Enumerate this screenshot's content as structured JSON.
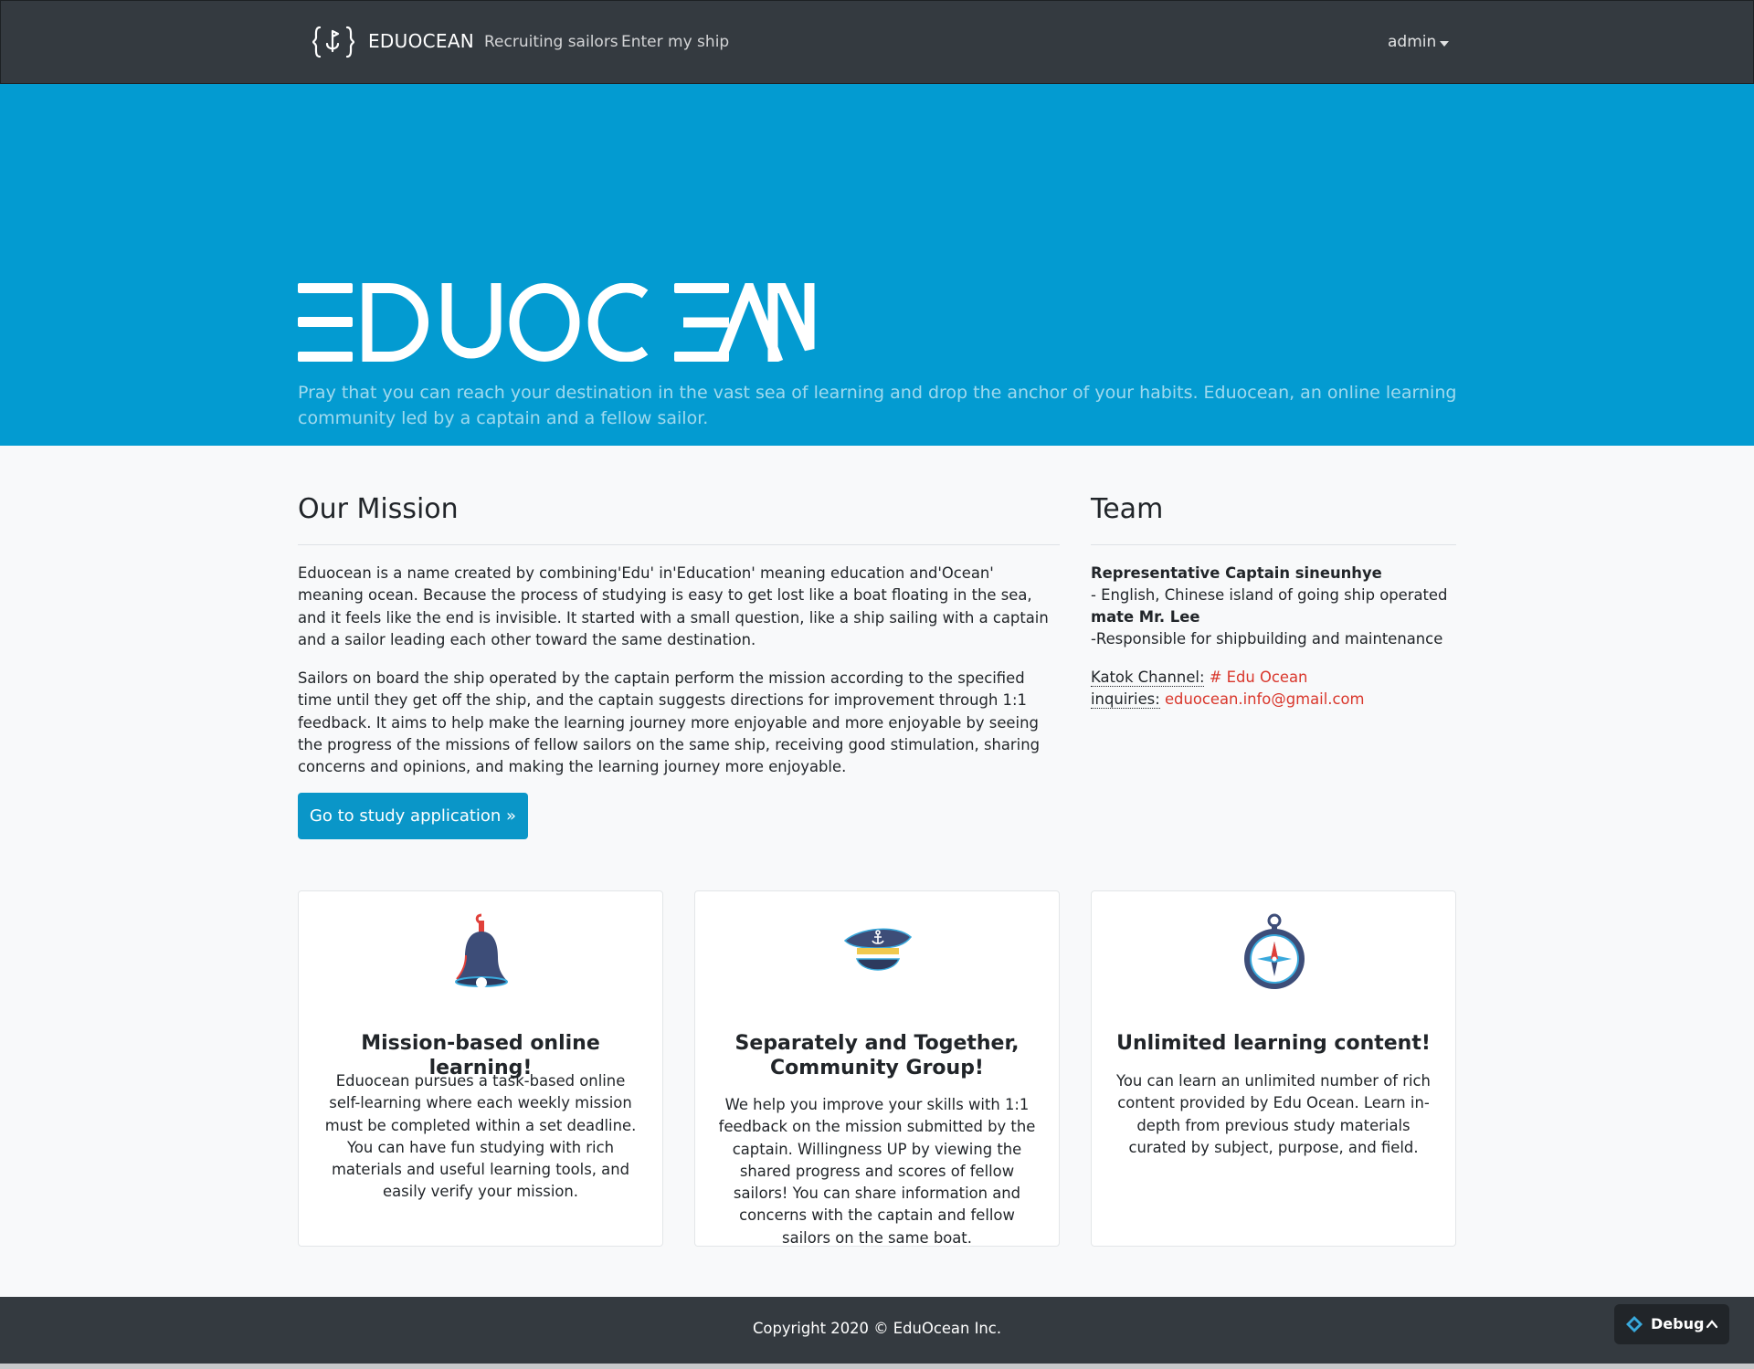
{
  "nav": {
    "brand": "EDUOCEAN",
    "links": [
      "Recruiting sailors",
      "Enter my ship"
    ],
    "user": "admin"
  },
  "hero": {
    "logo_text": "EDUOCEAN",
    "tagline": "Pray that you can reach your destination in the vast sea of learning and drop the anchor of your habits. Eduocean, an online learning community led by a captain and a fellow sailor."
  },
  "mission": {
    "heading": "Our Mission",
    "paragraphs": [
      "Eduocean is a name created by combining'Edu' in'Education' meaning education and'Ocean' meaning ocean. Because the process of studying is easy to get lost like a boat floating in the sea, and it feels like the end is invisible. It started with a small question, like a ship sailing with a captain and a sailor leading each other toward the same destination.",
      "Sailors on board the ship operated by the captain perform the mission according to the specified time until they get off the ship, and the captain suggests directions for improvement through 1:1 feedback. It aims to help make the learning journey more enjoyable and more enjoyable by seeing the progress of the missions of fellow sailors on the same ship, receiving good stimulation, sharing concerns and opinions, and making the learning journey more enjoyable."
    ],
    "button": "Go to study application »"
  },
  "team": {
    "heading": "Team",
    "members": [
      {
        "title": "Representative Captain sineunhye",
        "desc": "- English, Chinese island of going ship operated"
      },
      {
        "title": "mate Mr. Lee",
        "desc": "-Responsible for shipbuilding and maintenance"
      }
    ],
    "contacts": [
      {
        "label": "Katok Channel:",
        "value": "# Edu Ocean"
      },
      {
        "label": "inquiries:",
        "value": "eduocean.info@gmail.com"
      }
    ]
  },
  "features": [
    {
      "icon": "bell-icon",
      "title": "Mission-based online learning!",
      "text": "Eduocean pursues a task-based online self-learning where each weekly mission must be completed within a set deadline. You can have fun studying with rich materials and useful learning tools, and easily verify your mission."
    },
    {
      "icon": "captain-hat-icon",
      "title": "Separately and Together, Community Group!",
      "text": "We help you improve your skills with 1:1 feedback on the mission submitted by the captain. Willingness UP by viewing the shared progress and scores of fellow sailors! You can share information and concerns with the captain and fellow sailors on the same boat."
    },
    {
      "icon": "compass-icon",
      "title": "Unlimited learning content!",
      "text": "You can learn an unlimited number of rich content provided by Edu Ocean. Learn in-depth from previous study materials curated by subject, purpose, and field."
    }
  ],
  "footer": {
    "copyright": "Copyright 2020 © EduOcean Inc."
  },
  "debug": {
    "label": "Debug"
  },
  "colors": {
    "navbar": "#343a40",
    "hero": "#039bd1",
    "button": "#0a96c8",
    "link_red": "#d9362b"
  }
}
